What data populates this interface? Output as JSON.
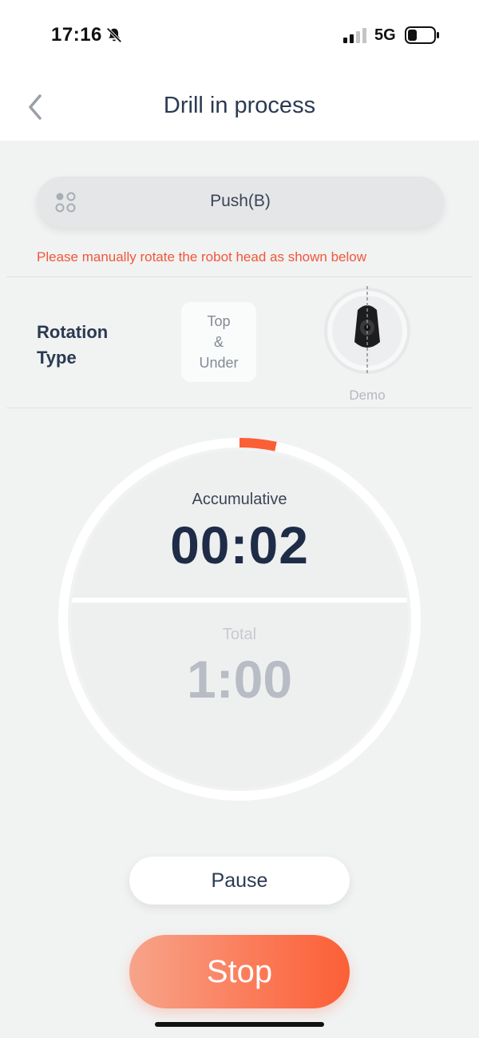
{
  "status_bar": {
    "time": "17:16",
    "network": "5G",
    "icons": [
      "bell-off-icon",
      "signal-icon",
      "battery-icon"
    ]
  },
  "nav": {
    "title": "Drill in process",
    "back_icon": "chevron-left-icon"
  },
  "mode": {
    "label": "Push(B)",
    "icon": "grid-dots-icon"
  },
  "warning": "Please manually rotate the robot head as shown below",
  "rotation": {
    "label_line1": "Rotation",
    "label_line2": "Type",
    "option_line1": "Top",
    "option_line2": "&",
    "option_line3": "Under",
    "demo_label": "Demo"
  },
  "timer": {
    "accumulative_label": "Accumulative",
    "accumulative_value": "00:02",
    "total_label": "Total",
    "total_value": "1:00",
    "progress_fraction": 0.033
  },
  "buttons": {
    "pause": "Pause",
    "stop": "Stop"
  },
  "colors": {
    "accent": "#fb5f36",
    "warning": "#f0573a",
    "primary_text": "#1f2c48",
    "background": "#f1f2f2"
  }
}
